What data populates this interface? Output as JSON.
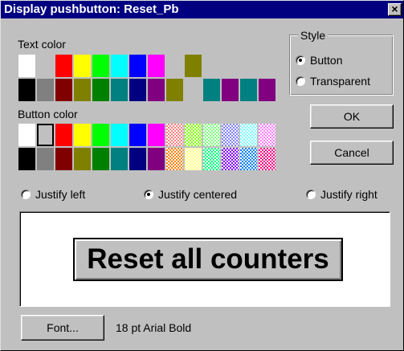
{
  "window": {
    "title": "Display pushbutton: Reset_Pb",
    "close_glyph": "×"
  },
  "text_color": {
    "label": "Text color",
    "row1": [
      "#ffffff",
      "#c0c0c0",
      "#ff0000",
      "#ffff00",
      "#00ff00",
      "#00ffff",
      "#0000ff",
      "#ff00ff",
      "#c0c0c0",
      "#808000",
      "#c0c0c0",
      "#c0c0c0",
      "#c0c0c0",
      "#c0c0c0"
    ],
    "row2": [
      "#000000",
      "#808080",
      "#800000",
      "#808000",
      "#008000",
      "#008080",
      "#000080",
      "#800080",
      "#808000",
      "#c0c0c0",
      "#008080",
      "#800080",
      "#008080",
      "#800080"
    ]
  },
  "button_color": {
    "label": "Button color",
    "row1": [
      "#ffffff",
      "#c0c0c0",
      "#ff0000",
      "#ffff00",
      "#00ff00",
      "#00ffff",
      "#0000ff",
      "#ff00ff",
      "#ff8080",
      "#80ff00",
      "#80ff80",
      "#8080ff",
      "#80ffff",
      "#ff80ff"
    ],
    "row2": [
      "#000000",
      "#808080",
      "#800000",
      "#808000",
      "#008000",
      "#008080",
      "#000080",
      "#800080",
      "#ff8000",
      "#ffff80",
      "#00ff80",
      "#8000ff",
      "#0080ff",
      "#ff0080"
    ],
    "dithered_row1": [
      false,
      false,
      false,
      false,
      false,
      false,
      false,
      false,
      true,
      true,
      true,
      true,
      true,
      true
    ],
    "dithered_row2": [
      false,
      false,
      false,
      false,
      false,
      false,
      false,
      false,
      true,
      true,
      true,
      true,
      true,
      true
    ],
    "selected_index": 1
  },
  "style": {
    "label": "Style",
    "options": [
      {
        "label": "Button",
        "checked": true
      },
      {
        "label": "Transparent",
        "checked": false
      }
    ]
  },
  "buttons": {
    "ok": "OK",
    "cancel": "Cancel",
    "font": "Font..."
  },
  "justify": [
    {
      "label": "Justify left",
      "checked": false
    },
    {
      "label": "Justify centered",
      "checked": true
    },
    {
      "label": "Justify right",
      "checked": false
    }
  ],
  "preview": {
    "text": "Reset all counters"
  },
  "font_description": "18 pt Arial Bold"
}
